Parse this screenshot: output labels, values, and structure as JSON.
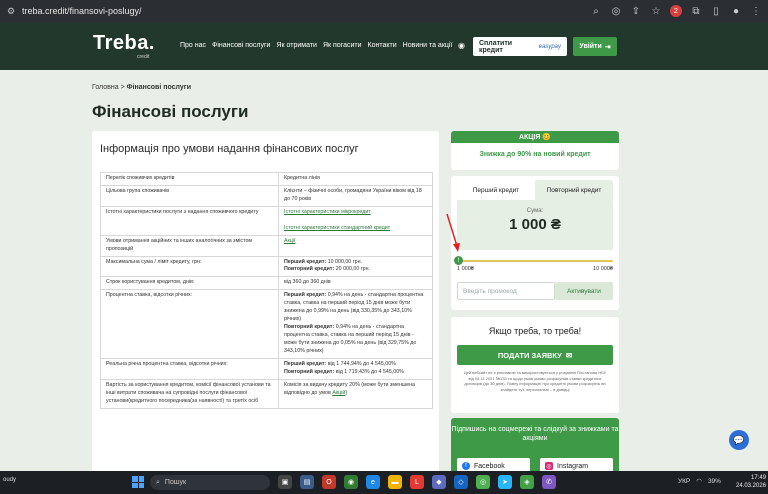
{
  "browser": {
    "url": "treba.credit/finansovi-poslugy/",
    "badge_count": "2"
  },
  "header": {
    "logo": "Treba.",
    "logo_sub": "credit",
    "nav": [
      "Про нас",
      "Фінансові послуги",
      "Як отримати",
      "Як погасити",
      "Контакти",
      "Новини та акції"
    ],
    "pay_label": "Сплатити кредит",
    "pay_brand": "easypay",
    "login_label": "Увійти"
  },
  "breadcrumb": {
    "home": "Головна",
    "separator": ">",
    "current": "Фінансові послуги"
  },
  "page_title": "Фінансові послуги",
  "info": {
    "heading": "Інформація про умови надання фінансових послуг",
    "rows": [
      {
        "label": "Перелік споживчих кредитів",
        "value": "Кредитна лінія"
      },
      {
        "label": "Цільова група споживачів",
        "value": "Клієнти – фізичні особи, громадяни України віком від 18 до 70 років"
      },
      {
        "label": "Істотні характеристики послуги з надання споживчого кредиту",
        "link1": "Істотні характеристики мікрокредит",
        "link2": "Істотні характеристики стандартний кредит"
      },
      {
        "label": "Умови отримання акційних та інших аналогічних за змістом пропозицій",
        "link1": "Акції"
      },
      {
        "label": "Максимальна сума / ліміт кредиту, грн:",
        "b1": "Перший кредит:",
        "t1": "10 000,00 грн.",
        "b2": "Повторний кредит:",
        "t2": "20 000,00 грн."
      },
      {
        "label": "Строк користування кредитом, днів:",
        "value": "від 360 до 360 днів"
      },
      {
        "label": "Процентна ставка, відсотки річних:",
        "b1": "Перший кредит:",
        "t1": "0,94% на день - стандартна процентна ставка, ставка на перший період 15 днів може бути знижена до 0,99% на день (від 330,35% до 343,10% річних)",
        "b2": "Повторний кредит:",
        "t2": "0,94% на день - стандартна процентна ставка, ставка на перший період 15 днів - може бути знижена до 0,05% на день (від 329,75% до 343,10% річних)"
      },
      {
        "label": "Реальна річна процентна ставка, відсотки річних:",
        "b1": "Перший кредит:",
        "t1": "від 1 744,94% до 4 545,00%",
        "b2": "Повторний кредит:",
        "t2": "від 1 719,43% до 4 545,00%"
      },
      {
        "label": "Вартість за користування кредитом, комісії фінансової установи та інші витрати споживача на супровідні послуги фінансової установи(кредитного посередника(за наявності) та третіх осіб",
        "value": "Комісія за видачу кредиту 20% (може бути зменшена відповідно до умов",
        "link1": "Акцій"
      }
    ]
  },
  "promo": {
    "badge": "АКЦІЯ 😊",
    "text": "Знижка до 90% на новий кредит"
  },
  "calculator": {
    "tabs": [
      "Перший кредит",
      "Повторний кредит"
    ],
    "active_tab": 1,
    "amount_label": "Сума:",
    "amount": "1 000 ₴",
    "min": "1 000₴",
    "max": "10 000₴",
    "slider_fraction": 0,
    "promo_placeholder": "Введіть промокод",
    "activate_label": "Активувати"
  },
  "apply": {
    "heading": "Якщо треба, то треба!",
    "button": "ПОДАТИ ЗАЯВКУ",
    "disclaimer": "Цей вебсайт не є рекламою та використовується у розумінні Постанови НБУ від 05.11.2021 №135 та щодо умов умови розрахунків ставки кредитних договорів (до 30 днів). Повну інформацію про кредитні умови розрахунок ви знайдете тут, персональні – в довідці"
  },
  "social": {
    "heading": "Підпишись на соцмережі та слідкуй за знижками та акціями",
    "facebook": "Facebook",
    "instagram": "Instagram"
  },
  "taskbar": {
    "weather": "oudy",
    "search": "Пошук",
    "lang": "УКР",
    "battery": "39%",
    "time": "17:49",
    "date": "24.03.2026"
  },
  "colors": {
    "brand_green": "#3f9a48",
    "header_dark": "#23382c",
    "page_bg": "#e9efe8"
  }
}
